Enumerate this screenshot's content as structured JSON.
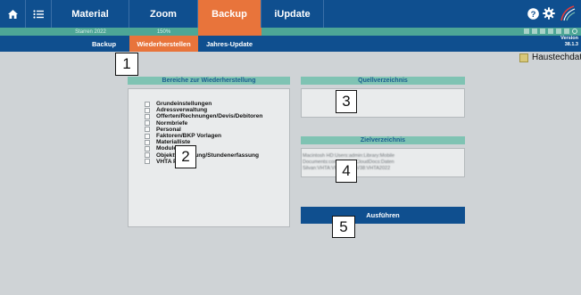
{
  "topbar": {
    "tabs": [
      {
        "label": "Material",
        "active": false
      },
      {
        "label": "Zoom",
        "active": false
      },
      {
        "label": "Backup",
        "active": true
      },
      {
        "label": "iUpdate",
        "active": false
      }
    ],
    "sub_values": [
      "Starren 2022",
      "150%"
    ]
  },
  "subtabs": [
    {
      "label": "Backup",
      "active": false
    },
    {
      "label": "Wiederherstellen",
      "active": true
    },
    {
      "label": "Jahres-Update",
      "active": false
    }
  ],
  "version": {
    "label": "Version",
    "number": "38.1.3"
  },
  "database": {
    "label": "Haustechdate"
  },
  "restore": {
    "title": "Bereiche zur Wiederherstellung",
    "items": [
      "Grundeinstellungen",
      "Adressverwaltung",
      "Offerten/Rechnungen/Devis/Debitoren",
      "Normbriefe",
      "Personal",
      "Faktoren/BKP Vorlagen",
      "Materialliste",
      "Module",
      "Objektverwaltung/Stundenerfassung",
      "VHTA Pay"
    ]
  },
  "source": {
    "title": "Quellverzeichnis"
  },
  "target": {
    "title": "Zielverzeichnis",
    "path": "Macintosh HD:Users:admin:Library:Mobile Documents:com~apple~CloudDocs:Daten Silvan:VHTA:VHTA2022:V38:VHTA2022"
  },
  "execute": {
    "label": "Ausführen"
  },
  "callouts": [
    "1",
    "2",
    "3",
    "4",
    "5"
  ],
  "colors": {
    "nav_bg": "#0f4f8f",
    "active": "#e8743b",
    "teal": "#4da696",
    "title_bg": "#7fc3b3"
  }
}
